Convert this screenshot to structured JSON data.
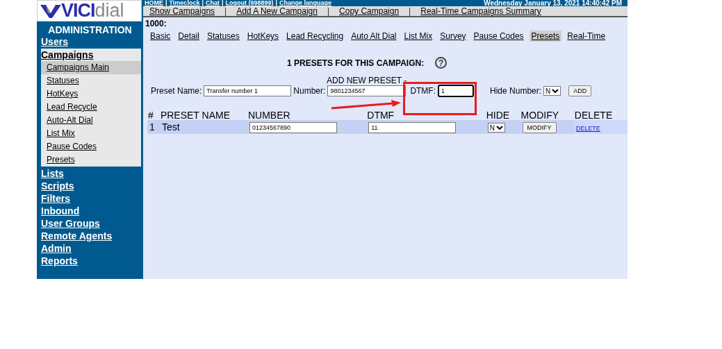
{
  "header": {
    "top_links": [
      "HOME",
      "Timeclock",
      "Chat",
      "Logout (998899)",
      "Change language"
    ],
    "top_separator": "|",
    "datetime": "Wednesday January 13, 2021 14:40:42 PM"
  },
  "logo": {
    "bold": "VICI",
    "light": "dial"
  },
  "sidebar": {
    "title": "ADMINISTRATION",
    "items": [
      {
        "label": "Users",
        "selected": false
      },
      {
        "label": "Campaigns",
        "selected": true,
        "children": [
          {
            "label": "Campaigns Main",
            "selected": true
          },
          {
            "label": "Statuses",
            "selected": false
          },
          {
            "label": "HotKeys",
            "selected": false
          },
          {
            "label": "Lead Recycle",
            "selected": false
          },
          {
            "label": "Auto-Alt Dial",
            "selected": false
          },
          {
            "label": "List Mix",
            "selected": false
          },
          {
            "label": "Pause Codes",
            "selected": false
          },
          {
            "label": "Presets",
            "selected": false
          }
        ]
      },
      {
        "label": "Lists",
        "selected": false
      },
      {
        "label": "Scripts",
        "selected": false
      },
      {
        "label": "Filters",
        "selected": false
      },
      {
        "label": "Inbound",
        "selected": false
      },
      {
        "label": "User Groups",
        "selected": false
      },
      {
        "label": "Remote Agents",
        "selected": false
      },
      {
        "label": "Admin",
        "selected": false
      },
      {
        "label": "Reports",
        "selected": false
      }
    ]
  },
  "nav_links": [
    "Show Campaigns",
    "Add A New Campaign",
    "Copy Campaign",
    "Real-Time Campaigns Summary"
  ],
  "nav_separator": "|",
  "campaign_id": "1000:",
  "tabs": [
    {
      "label": "Basic",
      "selected": false
    },
    {
      "label": "Detail",
      "selected": false
    },
    {
      "label": "Statuses",
      "selected": false
    },
    {
      "label": "HotKeys",
      "selected": false
    },
    {
      "label": "Lead Recycling",
      "selected": false
    },
    {
      "label": "Auto Alt Dial",
      "selected": false
    },
    {
      "label": "List Mix",
      "selected": false
    },
    {
      "label": "Survey",
      "selected": false
    },
    {
      "label": "Pause Codes",
      "selected": false
    },
    {
      "label": "Presets",
      "selected": true
    },
    {
      "label": "Real-Time",
      "selected": false
    }
  ],
  "title": "1 PRESETS FOR THIS CAMPAIGN:",
  "help": "?",
  "add_form": {
    "heading": "ADD NEW PRESET -",
    "preset_name_label": "Preset Name:",
    "preset_name": "Transfer number 1",
    "number_label": "Number:",
    "number": "9801234567",
    "dtmf_label": "DTMF:",
    "dtmf": "1",
    "hide_label": "Hide Number:",
    "hide": "N",
    "button": "ADD"
  },
  "table": {
    "columns": [
      "#",
      "PRESET NAME",
      "NUMBER",
      "DTMF",
      "HIDE",
      "MODIFY",
      "DELETE"
    ],
    "rows": [
      {
        "index": "1",
        "name": "Test",
        "number": "01234567890",
        "dtmf": "11",
        "hide": "N",
        "modify": "MODIFY",
        "delete": "DELETE"
      }
    ]
  },
  "annotations": {
    "highlight_box": true,
    "arrow": true
  }
}
